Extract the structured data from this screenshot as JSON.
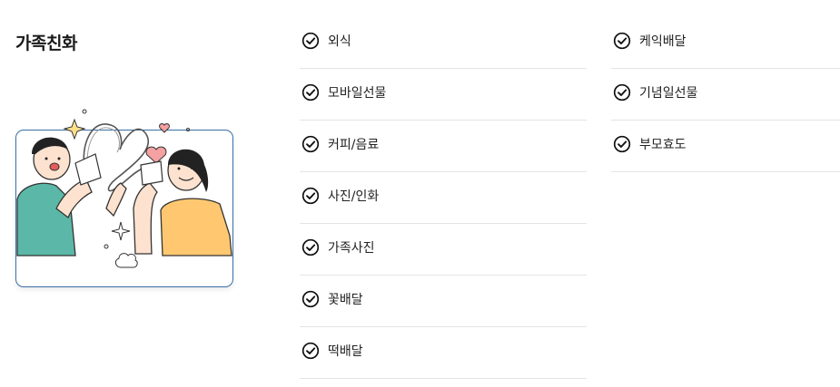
{
  "section": {
    "title": "가족친화"
  },
  "illustration": {
    "icon": "family-phone-illustration"
  },
  "columns": [
    {
      "items": [
        {
          "label": "외식",
          "icon": "check-circle-icon"
        },
        {
          "label": "모바일선물",
          "icon": "check-circle-icon"
        },
        {
          "label": "커피/음료",
          "icon": "check-circle-icon"
        },
        {
          "label": "사진/인화",
          "icon": "check-circle-icon"
        },
        {
          "label": "가족사진",
          "icon": "check-circle-icon"
        },
        {
          "label": "꽃배달",
          "icon": "check-circle-icon"
        },
        {
          "label": "떡배달",
          "icon": "check-circle-icon"
        }
      ]
    },
    {
      "items": [
        {
          "label": "케익배달",
          "icon": "check-circle-icon"
        },
        {
          "label": "기념일선물",
          "icon": "check-circle-icon"
        },
        {
          "label": "부모효도",
          "icon": "check-circle-icon"
        }
      ]
    }
  ],
  "colors": {
    "card_border": "#3a6fa8",
    "teal_shirt": "#5bb8a8",
    "yellow_shirt": "#ffc870",
    "heart": "#f4a1a1",
    "divider": "#e4e4e4"
  }
}
